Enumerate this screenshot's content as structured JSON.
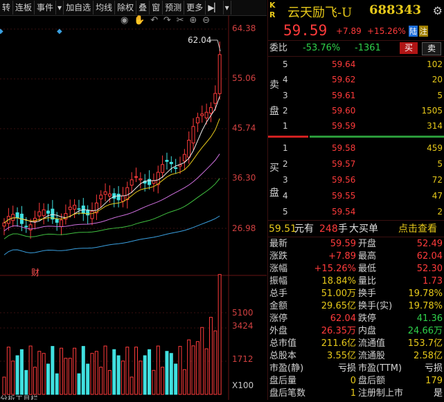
{
  "toolbar": {
    "items": [
      "转",
      "连板",
      "事件",
      "加自选",
      "均线",
      "除权",
      "叠",
      "窗",
      "预测",
      "更多"
    ],
    "dropdown_glyph": "▾",
    "expand_glyph": "▶▏"
  },
  "chart": {
    "price_levels": [
      "64.38",
      "55.06",
      "45.74",
      "36.30",
      "26.98"
    ],
    "high_marker": "62.04",
    "finance_marker": "财",
    "volume_levels": [
      "5100",
      "3424",
      "1712",
      "X100"
    ],
    "bottom_tab": "分析工具栏",
    "icons": [
      "eye-icon",
      "hand-icon",
      "undo-icon",
      "redo-icon",
      "scissors-icon",
      "plus-circle-icon",
      "minus-circle-icon"
    ]
  },
  "stock": {
    "badge_k": "K",
    "badge_r": "R",
    "name": "云天励飞-U",
    "code": "688343",
    "price": "59.59",
    "change": "+7.89",
    "change_pct": "+15.26%",
    "tag_lu": "陆",
    "tag_zhu": "注"
  },
  "commission": {
    "label": "委比",
    "ratio": "-53.76%",
    "diff": "-1361",
    "buy_btn": "买",
    "sell_btn": "卖"
  },
  "orderbook": {
    "sell_label_1": "卖",
    "sell_label_2": "盘",
    "buy_label_1": "买",
    "buy_label_2": "盘",
    "asks": [
      {
        "level": "5",
        "price": "59.64",
        "vol": "102"
      },
      {
        "level": "4",
        "price": "59.62",
        "vol": "20"
      },
      {
        "level": "3",
        "price": "59.61",
        "vol": "5"
      },
      {
        "level": "2",
        "price": "59.60",
        "vol": "1505"
      },
      {
        "level": "1",
        "price": "59.59",
        "vol": "314"
      }
    ],
    "bids": [
      {
        "level": "1",
        "price": "59.58",
        "vol": "459"
      },
      {
        "level": "2",
        "price": "59.57",
        "vol": "5"
      },
      {
        "level": "3",
        "price": "59.56",
        "vol": "72"
      },
      {
        "level": "4",
        "price": "59.55",
        "vol": "47"
      },
      {
        "level": "5",
        "price": "59.54",
        "vol": "2"
      }
    ]
  },
  "big_order": {
    "price": "59.51",
    "unit1": "元有",
    "qty": "248",
    "unit2": "手",
    "desc": "大买单",
    "link": "点击查看"
  },
  "quotes": [
    {
      "k1": "最新",
      "v1": "59.59",
      "c1": "red",
      "k2": "开盘",
      "v2": "52.49",
      "c2": "red"
    },
    {
      "k1": "涨跌",
      "v1": "+7.89",
      "c1": "red",
      "k2": "最高",
      "v2": "62.04",
      "c2": "red"
    },
    {
      "k1": "涨幅",
      "v1": "+15.26%",
      "c1": "red",
      "k2": "最低",
      "v2": "52.30",
      "c2": "red"
    },
    {
      "k1": "振幅",
      "v1": "18.84%",
      "c1": "yellow",
      "k2": "量比",
      "v2": "1.73",
      "c2": "red"
    },
    {
      "k1": "总手",
      "v1": "51.00万",
      "c1": "yellow",
      "k2": "换手",
      "v2": "19.78%",
      "c2": "yellow"
    },
    {
      "k1": "金额",
      "v1": "29.65亿",
      "c1": "yellow",
      "k2": "换手(实)",
      "v2": "19.78%",
      "c2": "yellow"
    },
    {
      "k1": "涨停",
      "v1": "62.04",
      "c1": "red",
      "k2": "跌停",
      "v2": "41.36",
      "c2": "green"
    },
    {
      "k1": "外盘",
      "v1": "26.35万",
      "c1": "red",
      "k2": "内盘",
      "v2": "24.66万",
      "c2": "green"
    },
    {
      "k1": "总市值",
      "v1": "211.6亿",
      "c1": "yellow",
      "k2": "流通值",
      "v2": "153.7亿",
      "c2": "yellow"
    },
    {
      "k1": "总股本",
      "v1": "3.55亿",
      "c1": "yellow",
      "k2": "流通股",
      "v2": "2.58亿",
      "c2": "yellow"
    },
    {
      "k1": "市盈(静)",
      "v1": "亏损",
      "c1": "white",
      "k2": "市盈(TTM)",
      "v2": "亏损",
      "c2": "white"
    },
    {
      "k1": "盘后量",
      "v1": "0",
      "c1": "yellow",
      "k2": "盘后额",
      "v2": "179",
      "c2": "yellow"
    },
    {
      "k1": "盘后笔数",
      "v1": "1",
      "c1": "yellow",
      "k2": "注册制上市",
      "v2": "是",
      "c2": "white"
    }
  ],
  "colors": {
    "up": "#ff3b3b",
    "down": "#2fd04a",
    "accent": "#e6c81a",
    "ma5": "#f0f0f0",
    "ma10": "#e6c81a",
    "ma20": "#d070e0",
    "ma30": "#40c040",
    "ma60": "#3aa0e0"
  }
}
